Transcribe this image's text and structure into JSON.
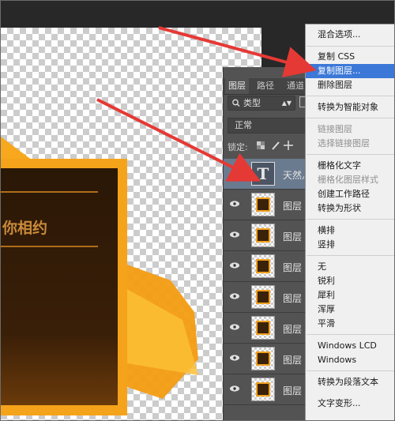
{
  "layers_panel": {
    "tabs": [
      "图层",
      "路径",
      "通道"
    ],
    "filter_label": "类型",
    "blend_mode": "正常",
    "lock_label": "锁定:",
    "text_layer_name": "天然灬",
    "layer_names": [
      "图层",
      "图层",
      "图层",
      "图层",
      "图层",
      "图层",
      "图层"
    ]
  },
  "artwork": {
    "heading_text": "你相约"
  },
  "context_menu": {
    "items": [
      {
        "label": "混合选项...",
        "state": "normal"
      },
      {
        "label": "复制 CSS",
        "state": "normal"
      },
      {
        "label": "复制图层...",
        "state": "highlighted"
      },
      {
        "label": "删除图层",
        "state": "normal"
      },
      {
        "label": "转换为智能对象",
        "state": "normal"
      },
      {
        "label": "链接图层",
        "state": "disabled"
      },
      {
        "label": "选择链接图层",
        "state": "disabled"
      },
      {
        "label": "栅格化文字",
        "state": "normal"
      },
      {
        "label": "栅格化图层样式",
        "state": "disabled"
      },
      {
        "label": "创建工作路径",
        "state": "normal"
      },
      {
        "label": "转换为形状",
        "state": "normal"
      },
      {
        "label": "横排",
        "state": "normal"
      },
      {
        "label": "竖排",
        "state": "normal"
      },
      {
        "label": "无",
        "state": "normal"
      },
      {
        "label": "锐利",
        "state": "normal"
      },
      {
        "label": "犀利",
        "state": "normal"
      },
      {
        "label": "浑厚",
        "state": "normal"
      },
      {
        "label": "平滑",
        "state": "normal"
      },
      {
        "label": "Windows LCD",
        "state": "normal"
      },
      {
        "label": "Windows",
        "state": "normal"
      },
      {
        "label": "转换为段落文本",
        "state": "normal"
      },
      {
        "label": "文字变形...",
        "state": "normal"
      }
    ]
  },
  "colors": {
    "accent_orange": "#f5a31a",
    "menu_highlight": "#3b78d8",
    "annotation_arrow": "#e53935",
    "panel_bg": "#535353"
  },
  "icons": {
    "eye": "eye-icon",
    "search": "search-icon",
    "text_layer": "text-layer-icon"
  }
}
